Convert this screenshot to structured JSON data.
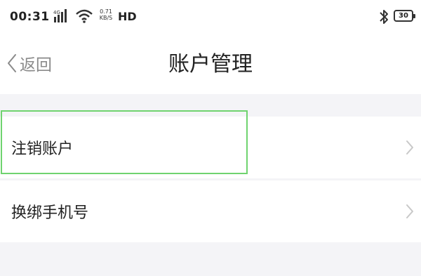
{
  "status_bar": {
    "time": "00:31",
    "network": "4G",
    "speed_value": "0.71",
    "speed_unit": "KB/S",
    "hd_label": "HD",
    "battery": "30"
  },
  "nav": {
    "back_label": "返回",
    "title": "账户管理"
  },
  "menu": {
    "items": [
      {
        "label": "注销账户"
      },
      {
        "label": "换绑手机号"
      }
    ]
  },
  "colors": {
    "background": "#f4f4f7",
    "highlight": "#6fd36f"
  }
}
